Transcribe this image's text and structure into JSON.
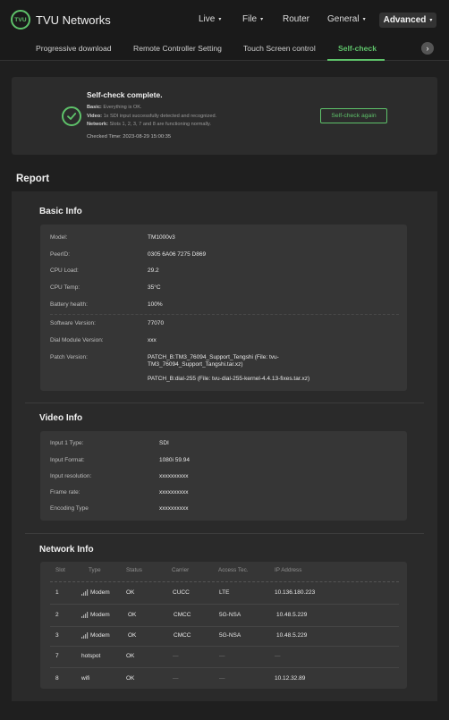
{
  "header": {
    "logo_badge": "TVU",
    "brand": "TVU Networks",
    "nav": [
      {
        "label": "Live",
        "caret": "▾"
      },
      {
        "label": "File",
        "caret": "▾"
      },
      {
        "label": "Router",
        "caret": ""
      },
      {
        "label": "General",
        "caret": "▾"
      }
    ],
    "advanced": "Advanced",
    "advanced_caret": "▾"
  },
  "tabs": {
    "items": [
      "Progressive download",
      "Remote Controller Setting",
      "Touch Screen control",
      "Self-check"
    ],
    "active": "Self-check",
    "next_icon": "›"
  },
  "selfcheck": {
    "title": "Self-check complete.",
    "basic_label": "Basic:",
    "basic_text": "Everything is OK.",
    "video_label": "Video:",
    "video_text": "1x SDI input successfully detected and recognized.",
    "network_label": "Network:",
    "network_text": "Slots 1, 2, 3, 7 and 8 are functioning normally.",
    "checked_time": "Checked Time: 2023-08-29 15:00:35",
    "button": "Self-check again",
    "accent": "#5ec26a"
  },
  "report": {
    "title": "Report",
    "basic_info": {
      "title": "Basic Info",
      "rows": [
        {
          "label": "Model:",
          "value": "TM1000v3"
        },
        {
          "label": "PeerID:",
          "value": "0305 6A06 7275 D869"
        },
        {
          "label": "CPU Load:",
          "value": "29.2"
        },
        {
          "label": "CPU Temp:",
          "value": "35°C"
        },
        {
          "label": "Battery health:",
          "value": "100%"
        },
        {
          "label": "Software Version:",
          "value": "77070"
        },
        {
          "label": "Dial Module Version:",
          "value": "xxx"
        },
        {
          "label": "Patch Version:",
          "value": "PATCH_B:TM3_76094_Support_Tengshi (File: tvu-",
          "value2": "TM3_76094_Support_Tangshi.tar.xz)",
          "value3": "PATCH_B:dial-255 (File: tvu-dial-255-kernel-4.4.13-fixes.tar.xz)"
        }
      ]
    },
    "video_info": {
      "title": "Video Info",
      "rows": [
        {
          "label": "Input 1 Type:",
          "value": "SDI"
        },
        {
          "label": "Input Format:",
          "value": "1080i 59.94"
        },
        {
          "label": "Input resolution:",
          "value": "xxxxxxxxxx"
        },
        {
          "label": "Frame rate:",
          "value": "xxxxxxxxxx"
        },
        {
          "label": "Encoding Type",
          "value": "xxxxxxxxxx"
        }
      ]
    },
    "network_info": {
      "title": "Network Info",
      "columns": [
        "Slot",
        "Type",
        "Status",
        "Carrier",
        "Access Tec.",
        "IP Address"
      ],
      "rows": [
        {
          "slot": "1",
          "type": "Modem",
          "signal": true,
          "status": "OK",
          "carrier": "CUCC",
          "access": "LTE",
          "ip": "10.136.180.223"
        },
        {
          "slot": "2",
          "type": "Modem",
          "signal": true,
          "status": "OK",
          "carrier": "CMCC",
          "access": "5G-NSA",
          "ip": "10.48.5.229"
        },
        {
          "slot": "3",
          "type": "Modem",
          "signal": true,
          "status": "OK",
          "carrier": "CMCC",
          "access": "5G-NSA",
          "ip": "10.48.5.229"
        },
        {
          "slot": "7",
          "type": "hotspot",
          "signal": false,
          "status": "OK",
          "carrier": "—",
          "access": "—",
          "ip": "—"
        },
        {
          "slot": "8",
          "type": "wifi",
          "signal": false,
          "status": "OK",
          "carrier": "—",
          "access": "—",
          "ip": "10.12.32.89"
        }
      ]
    }
  }
}
